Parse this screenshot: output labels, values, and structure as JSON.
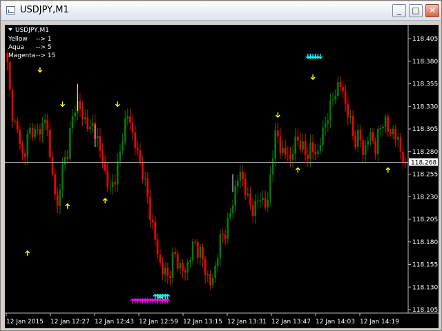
{
  "window": {
    "title": "USDJPY,M1",
    "buttons": [
      "minimize",
      "maximize",
      "close"
    ]
  },
  "chart_info": {
    "symbol_label": "USDJPY,M1",
    "legend": [
      {
        "label": "Yellow",
        "value": "--> 1"
      },
      {
        "label": "Aqua",
        "value": "--> 5"
      },
      {
        "label": "Magenta",
        "value": "--> 15"
      }
    ]
  },
  "colors": {
    "background": "#000000",
    "bull": "#008000",
    "bear": "#ff0000",
    "yellow": "#ffff00",
    "aqua": "#00ffff",
    "magenta": "#ff00ff",
    "price_line": "#c0c0c0",
    "text": "#ffffff"
  },
  "current_price": "118.268",
  "chart_data": {
    "type": "candlestick",
    "ylim": [
      118.1,
      118.415
    ],
    "y_ticks": [
      "118.405",
      "118.380",
      "118.355",
      "118.330",
      "118.305",
      "118.280",
      "118.255",
      "118.230",
      "118.205",
      "118.180",
      "118.155",
      "118.130",
      "118.105"
    ],
    "x_ticks": [
      "12 Jan 2015",
      "12 Jan 12:27",
      "12 Jan 12:43",
      "12 Jan 12:59",
      "12 Jan 13:15",
      "12 Jan 13:31",
      "12 Jan 13:47",
      "12 Jan 14:03",
      "12 Jan 14:19"
    ],
    "close_path": [
      118.375,
      118.335,
      118.312,
      118.3,
      118.295,
      118.26,
      118.3,
      118.305,
      118.3,
      118.3,
      118.31,
      118.305,
      118.32,
      118.268,
      118.25,
      118.21,
      118.245,
      118.265,
      118.275,
      118.3,
      118.32,
      118.335,
      118.33,
      118.31,
      118.32,
      118.3,
      118.31,
      118.3,
      118.28,
      118.27,
      118.25,
      118.235,
      118.245,
      118.255,
      118.27,
      118.3,
      118.315,
      118.32,
      118.3,
      118.285,
      118.27,
      118.26,
      118.24,
      118.22,
      118.2,
      118.18,
      118.16,
      118.15,
      118.145,
      118.14,
      118.16,
      118.165,
      118.155,
      118.15,
      118.145,
      118.16,
      118.17,
      118.18,
      118.17,
      118.165,
      118.15,
      118.14,
      118.13,
      118.15,
      118.17,
      118.185,
      118.19,
      118.2,
      118.215,
      118.235,
      118.25,
      118.255,
      118.245,
      118.225,
      118.22,
      118.215,
      118.225,
      118.23,
      118.225,
      118.215,
      118.26,
      118.29,
      118.3,
      118.285,
      118.275,
      118.28,
      118.27,
      118.285,
      118.295,
      118.29,
      118.28,
      118.275,
      118.285,
      118.28,
      118.275,
      118.29,
      118.3,
      118.32,
      118.325,
      118.34,
      118.35,
      118.355,
      118.345,
      118.33,
      118.315,
      118.3,
      118.29,
      118.3,
      118.28,
      118.285,
      118.3,
      118.295,
      118.28,
      118.305,
      118.315,
      118.31,
      118.3,
      118.305,
      118.295,
      118.29,
      118.275,
      118.268
    ],
    "markers": [
      {
        "color": "yellow",
        "dir": "down",
        "index": 13,
        "price": 118.368
      },
      {
        "color": "yellow",
        "dir": "up",
        "index": 8,
        "price": 118.17
      },
      {
        "color": "yellow",
        "dir": "down",
        "index": 22,
        "price": 118.33
      },
      {
        "color": "yellow",
        "dir": "up",
        "index": 24,
        "price": 118.222
      },
      {
        "color": "yellow",
        "dir": "down",
        "index": 44,
        "price": 118.33
      },
      {
        "color": "yellow",
        "dir": "up",
        "index": 39,
        "price": 118.228
      },
      {
        "color": "yellow",
        "dir": "up",
        "index": 61,
        "price": 118.12
      },
      {
        "color": "yellow",
        "dir": "down",
        "index": 108,
        "price": 118.318
      },
      {
        "color": "yellow",
        "dir": "up",
        "index": 116,
        "price": 118.262
      },
      {
        "color": "yellow",
        "dir": "down",
        "index": 122,
        "price": 118.36
      },
      {
        "color": "yellow",
        "dir": "up",
        "index": 152,
        "price": 118.262
      }
    ],
    "aqua_cluster": {
      "from_index": 59,
      "to_index": 64,
      "price": 118.122
    },
    "aqua_cluster_top": {
      "from_index": 120,
      "to_index": 125,
      "price": 118.383
    },
    "magenta_cluster": {
      "from_index": 50,
      "to_index": 64,
      "price": 118.117
    }
  }
}
